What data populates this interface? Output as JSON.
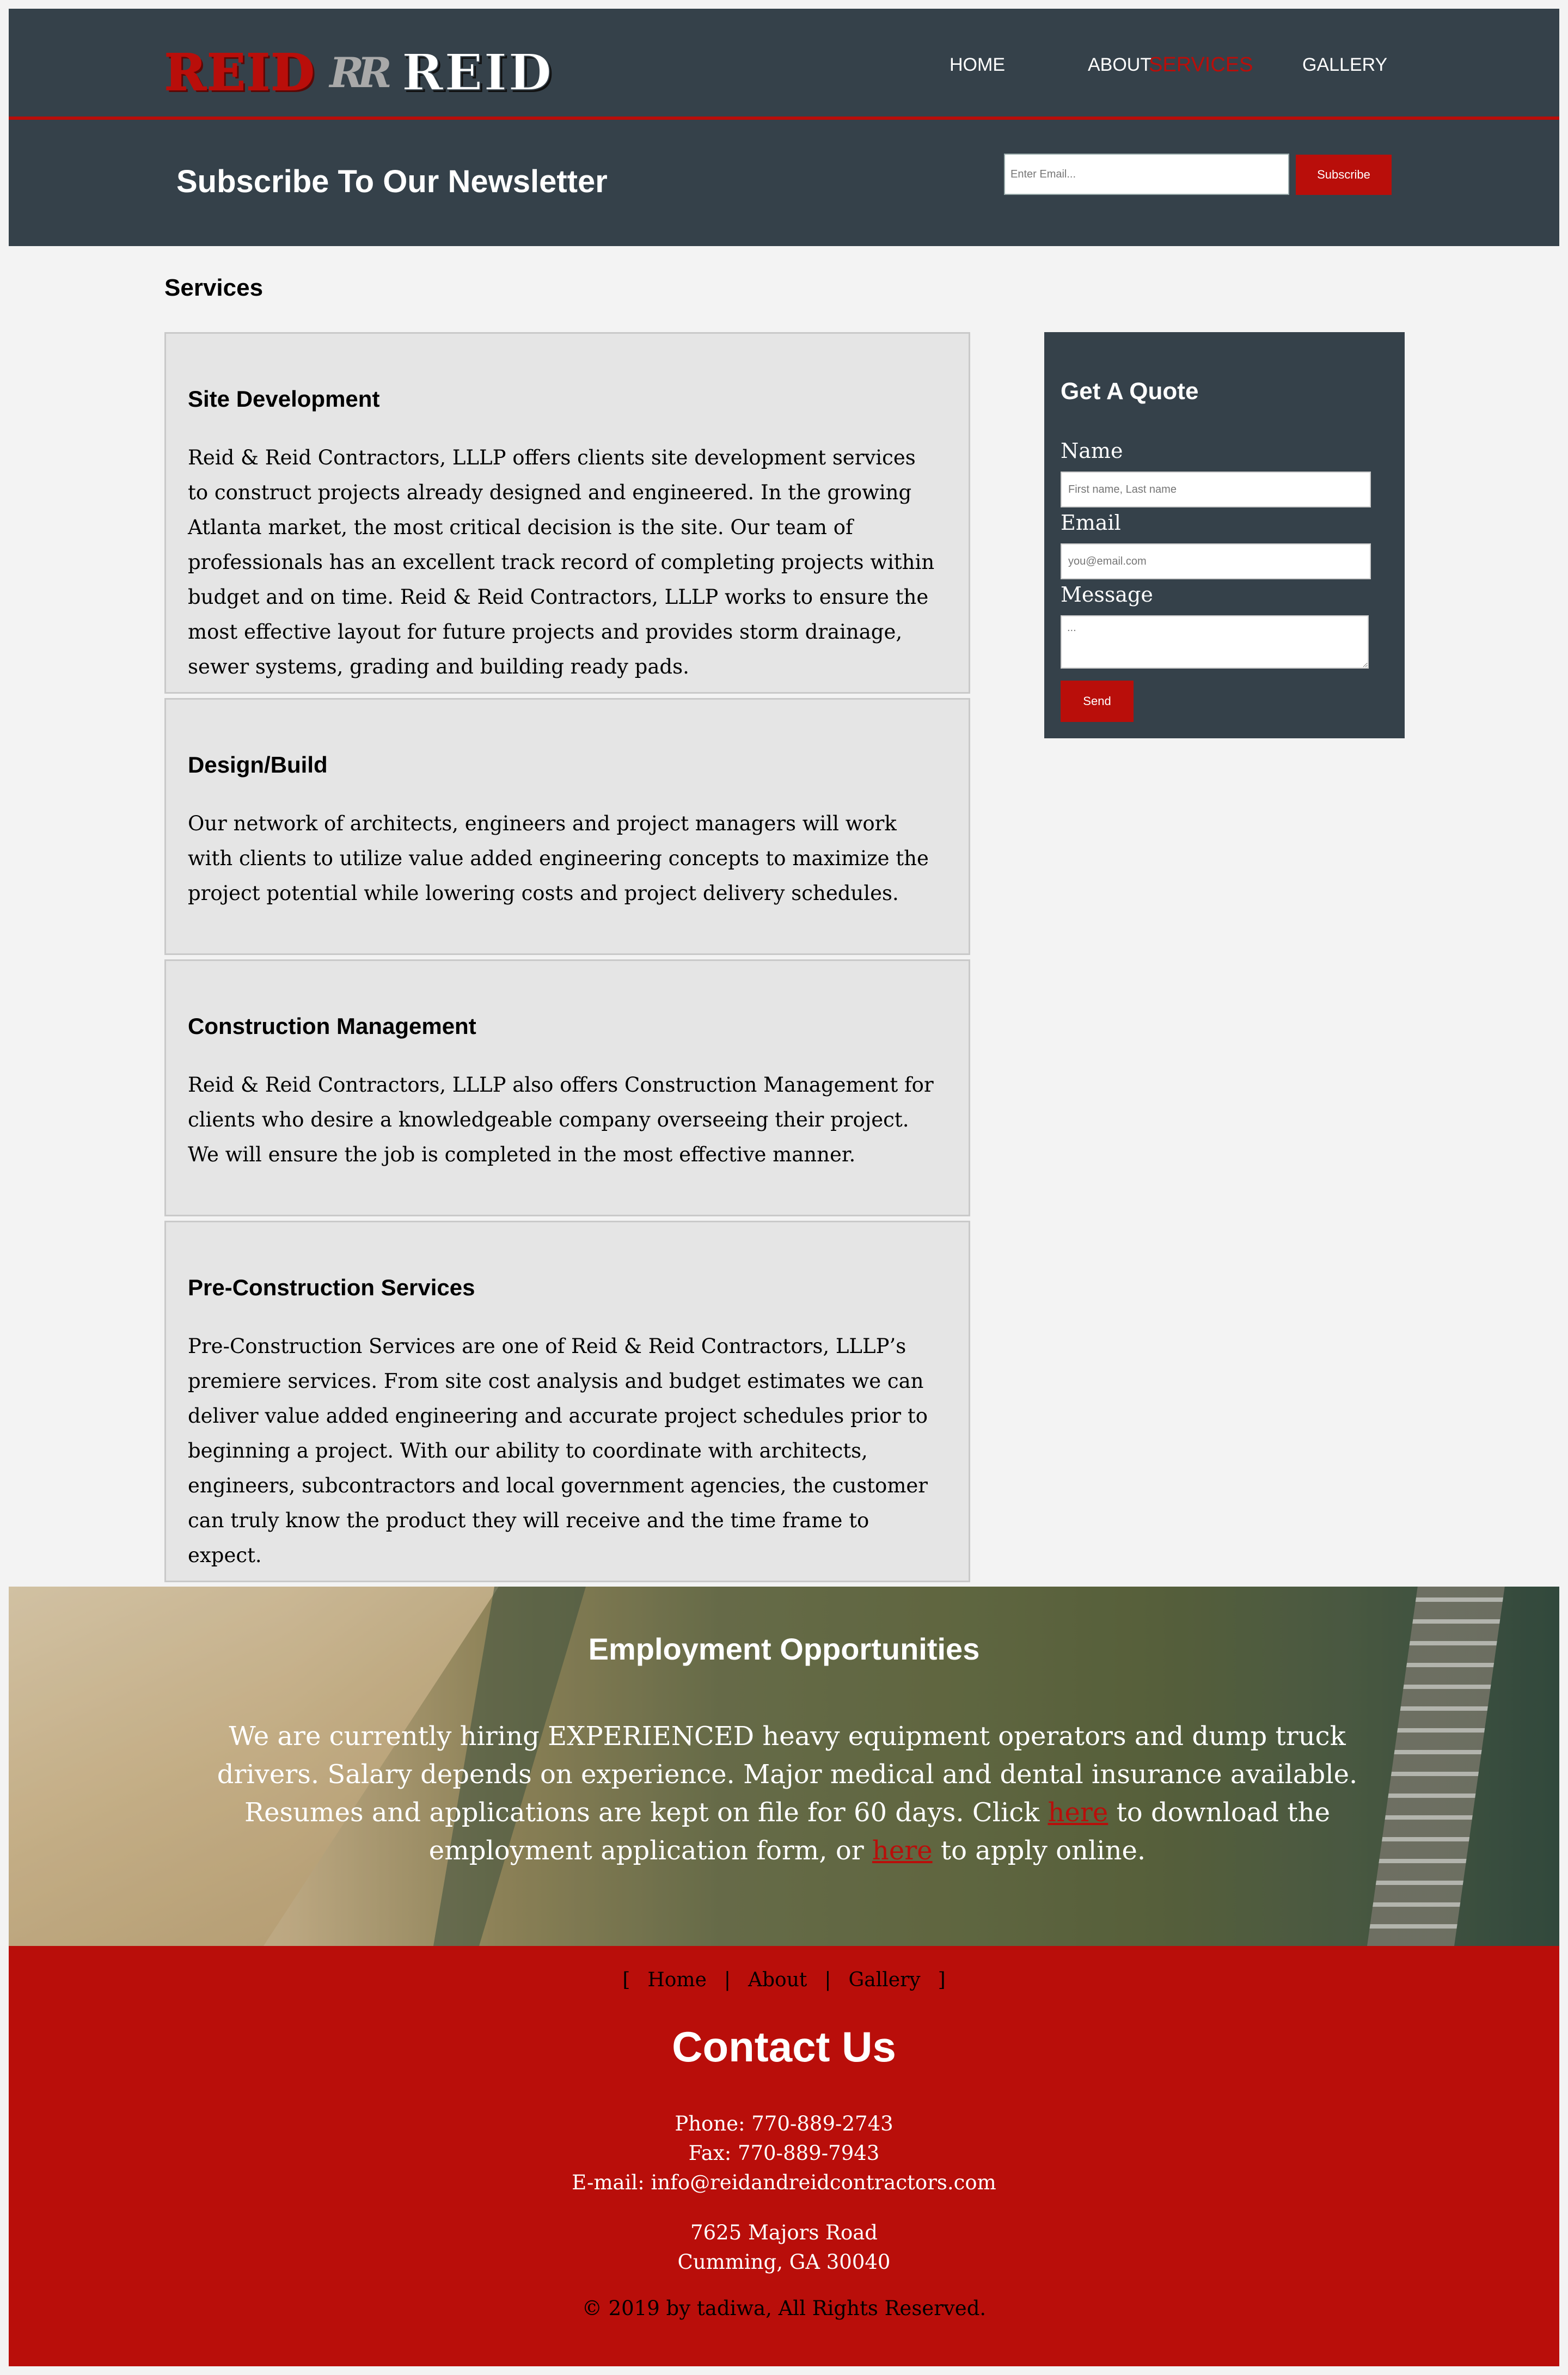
{
  "header": {
    "logo_left": "REID",
    "logo_mark": "RR",
    "logo_right": "REID",
    "nav": [
      "HOME",
      "ABOUT",
      "SERVICES",
      "GALLERY"
    ],
    "active_nav": "SERVICES"
  },
  "newsletter": {
    "title": "Subscribe To Our Newsletter",
    "placeholder": "Enter Email...",
    "button": "Subscribe"
  },
  "main": {
    "section_title": "Services",
    "services": [
      {
        "title": "Site Development",
        "body": "Reid & Reid Contractors, LLLP offers clients site development services to construct projects already designed and engineered. In the growing Atlanta market, the most critical decision is the site. Our team of professionals has an excellent track record of completing projects within budget and on time. Reid & Reid Contractors, LLLP works to ensure the most effective layout for future projects and provides storm drainage, sewer systems, grading and building ready pads."
      },
      {
        "title": "Design/Build",
        "body": "Our network of architects, engineers and project managers will work with clients to utilize value added engineering concepts to maximize the project potential while lowering costs and project delivery schedules."
      },
      {
        "title": "Construction Management",
        "body": "Reid & Reid Contractors, LLLP also offers Construction Management for clients who desire a knowledgeable company overseeing their project. We will ensure the job is completed in the most effective manner."
      },
      {
        "title": "Pre-Construction Services",
        "body": "Pre-Construction Services are one of Reid & Reid Contractors, LLLP’s premiere services. From site cost analysis and budget estimates we can deliver value added engineering and accurate project schedules prior to beginning a project. With our ability to coordinate with architects, engineers, subcontractors and local government agencies, the customer can truly know the product they will receive and the time frame to expect."
      }
    ]
  },
  "quote": {
    "title": "Get A Quote",
    "name_label": "Name",
    "name_placeholder": "First name, Last name",
    "email_label": "Email",
    "email_placeholder": "you@email.com",
    "message_label": "Message",
    "message_placeholder": "...",
    "send": "Send"
  },
  "employment": {
    "title": "Employment Opportunities",
    "text_1": "We are currently hiring EXPERIENCED heavy equipment operators and dump truck drivers. Salary depends on experience. Major medical and dental insurance available. Resumes and applications are kept on file for 60 days. Click ",
    "link_1": "here",
    "text_2": " to download the employment application form, or ",
    "link_2": "here",
    "text_3": " to apply online."
  },
  "footer": {
    "open_bracket": "[",
    "links": [
      "Home",
      "About",
      "Gallery"
    ],
    "separator": "|",
    "close_bracket": "]",
    "title": "Contact Us",
    "phone": "Phone: 770-889-2743",
    "fax": "Fax: 770-889-7943",
    "email": "E-mail: info@reidandreidcontractors.com",
    "address_1": "7625 Majors Road",
    "address_2": "Cumming, GA 30040",
    "copyright": "© 2019 by tadiwa, All Rights Reserved."
  },
  "colors": {
    "dark": "#35414a",
    "accent": "#b90e0a",
    "page": "#f3f3f3",
    "card": "#e5e5e5"
  }
}
